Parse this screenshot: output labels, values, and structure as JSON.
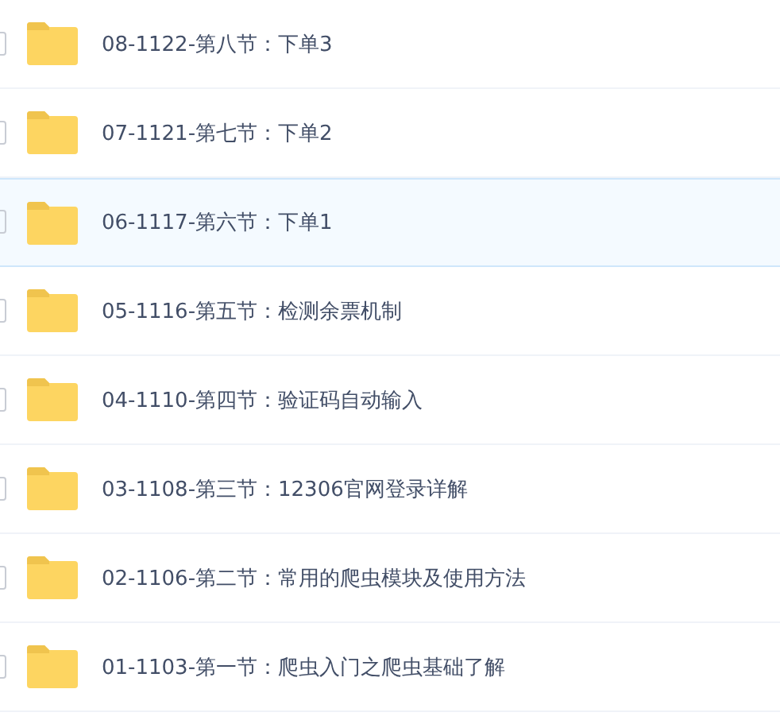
{
  "files": [
    {
      "name": "08-1122-第八节：下单3",
      "selected": false
    },
    {
      "name": "07-1121-第七节：下单2",
      "selected": false
    },
    {
      "name": "06-1117-第六节：下单1",
      "selected": true
    },
    {
      "name": "05-1116-第五节：检测余票机制",
      "selected": false
    },
    {
      "name": "04-1110-第四节：验证码自动输入",
      "selected": false
    },
    {
      "name": "03-1108-第三节：12306官网登录详解",
      "selected": false
    },
    {
      "name": "02-1106-第二节：常用的爬虫模块及使用方法",
      "selected": false
    },
    {
      "name": "01-1103-第一节：爬虫入门之爬虫基础了解",
      "selected": false
    }
  ]
}
